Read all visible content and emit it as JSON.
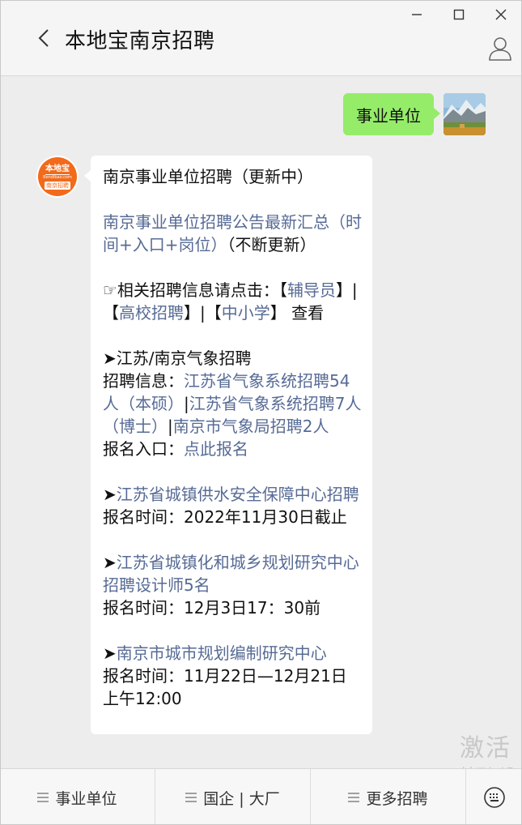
{
  "window": {
    "minimize_icon": "minimize-icon",
    "maximize_icon": "maximize-icon",
    "close_icon": "close-icon"
  },
  "header": {
    "title": "本地宝南京招聘",
    "back_icon": "chevron-left-icon",
    "profile_icon": "person-icon"
  },
  "chat": {
    "user_message": "事业单位",
    "bot_avatar": {
      "logo_text": "本地宝",
      "logo_url": "Bendibao.com",
      "logo_sub": "南京招聘",
      "brand_color": "#f26a1b"
    },
    "bot_message": {
      "heading": "南京事业单位招聘（更新中）",
      "summary_link": "南京事业单位招聘公告最新汇总（时间+入口+岗位）",
      "summary_suffix": "（不断更新）",
      "related_prefix": "☞相关招聘信息请点击：",
      "related_open1": "【",
      "related_link1": "辅导员",
      "related_sep1": "】|【",
      "related_link2": "高校招聘",
      "related_sep2": "】|【",
      "related_link3": "中小学",
      "related_suffix": "】 查看",
      "arrow": "➤",
      "s1_title": "江苏/南京气象招聘",
      "s1_info_label": "招聘信息：",
      "s1_link1": "江苏省气象系统招聘54人（本硕）",
      "s1_bar1": "|",
      "s1_link2": "江苏省气象系统招聘7人（博士）",
      "s1_bar2": "|",
      "s1_link3": "南京市气象局招聘2人",
      "s1_entry_label": "报名入口：",
      "s1_entry_link": "点此报名",
      "s2_title": "江苏省城镇供水安全保障中心招聘",
      "s2_time": "报名时间：2022年11月30日截止",
      "s3_title": "江苏省城镇化和城乡规划研究中心招聘设计师5名",
      "s3_time": "报名时间：12月3日17：30前",
      "s4_title": "南京市城市规划编制研究中心",
      "s4_time": "报名时间：11月22日—12月21日上午12:00"
    }
  },
  "watermark": {
    "line1": "激活 W",
    "line2": "转到\"设"
  },
  "bottom_menu": {
    "items": [
      {
        "label": "事业单位"
      },
      {
        "label": "国企 | 大厂"
      },
      {
        "label": "更多招聘"
      }
    ],
    "keyboard_icon": "keyboard-icon"
  },
  "colors": {
    "link": "#576b95",
    "user_bubble": "#95ec69",
    "background": "#ededed"
  }
}
